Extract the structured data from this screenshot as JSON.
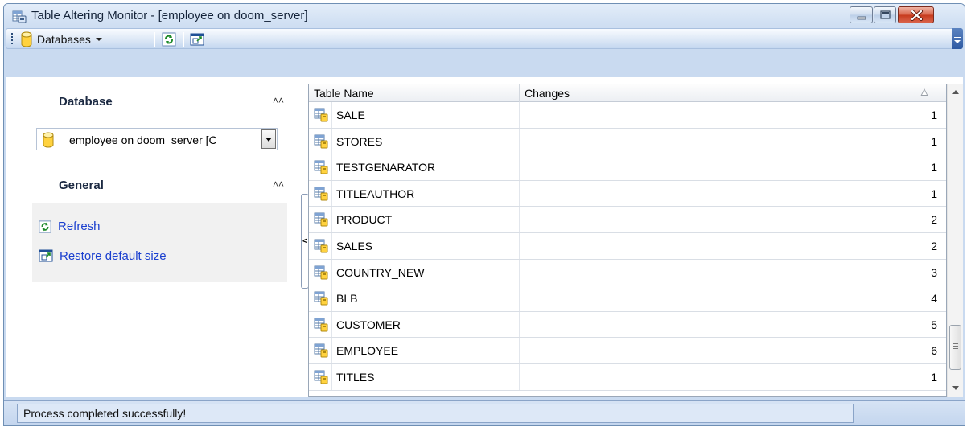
{
  "window": {
    "title": "Table Altering Monitor - [employee on doom_server]"
  },
  "toolbar": {
    "databases_label": "Databases"
  },
  "left_panel": {
    "database_section": {
      "title": "Database"
    },
    "database_combo": {
      "value": "employee on doom_server [C"
    },
    "general_section": {
      "title": "General"
    },
    "links": [
      {
        "label": "Refresh",
        "icon": "refresh-icon"
      },
      {
        "label": "Restore default size",
        "icon": "restore-size-icon"
      }
    ]
  },
  "grid": {
    "columns": [
      "Table Name",
      "Changes"
    ],
    "rows": [
      {
        "name": "SALE",
        "changes": "1"
      },
      {
        "name": "STORES",
        "changes": "1"
      },
      {
        "name": "TESTGENARATOR",
        "changes": "1"
      },
      {
        "name": "TITLEAUTHOR",
        "changes": "1"
      },
      {
        "name": "PRODUCT",
        "changes": "2"
      },
      {
        "name": "SALES",
        "changes": "2"
      },
      {
        "name": "COUNTRY_NEW",
        "changes": "3"
      },
      {
        "name": "BLB",
        "changes": "4"
      },
      {
        "name": "CUSTOMER",
        "changes": "5"
      },
      {
        "name": "EMPLOYEE",
        "changes": "6"
      },
      {
        "name": "TITLES",
        "changes": "1"
      }
    ]
  },
  "statusbar": {
    "message": "Process completed successfully!"
  },
  "colors": {
    "frame": "#c9daf0",
    "link": "#1a3fcf",
    "close_button": "#c73a1d"
  }
}
